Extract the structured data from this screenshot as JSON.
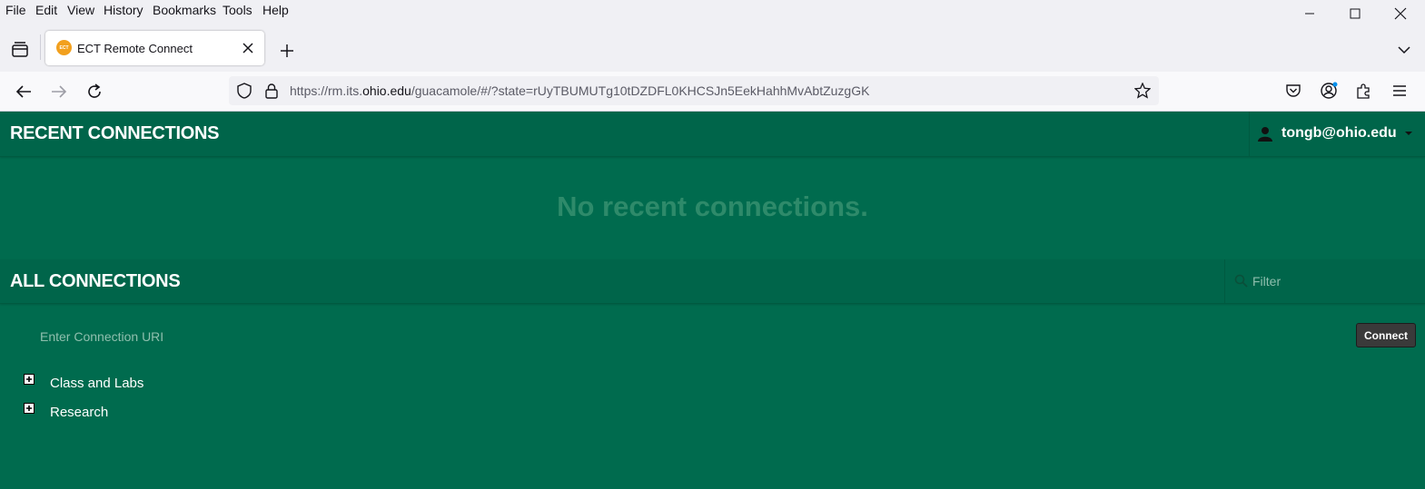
{
  "menu": [
    "File",
    "Edit",
    "View",
    "History",
    "Bookmarks",
    "Tools",
    "Help"
  ],
  "tab": {
    "title": "ECT Remote Connect",
    "favicon_text": "ECT"
  },
  "address": {
    "prefix": "https://rm.its.",
    "domain": "ohio.edu",
    "path": "/guacamole/#/?state=rUyTBUMUTg10tDZDFL0KHCSJn5EekHahhMvAbtZuzgGK"
  },
  "recent": {
    "title": "RECENT CONNECTIONS",
    "empty_message": "No recent connections."
  },
  "user": {
    "name": "tongb@ohio.edu"
  },
  "all": {
    "title": "ALL CONNECTIONS",
    "filter_placeholder": "Filter"
  },
  "connect": {
    "uri_placeholder": "Enter Connection URI",
    "button_label": "Connect"
  },
  "groups": [
    {
      "label": "Class and Labs"
    },
    {
      "label": "Research"
    }
  ],
  "colors": {
    "page_bg": "#006b4e",
    "header_bg": "#00654a",
    "muted_text": "#2e8a6a",
    "connect_bg": "#3a3a3a"
  }
}
